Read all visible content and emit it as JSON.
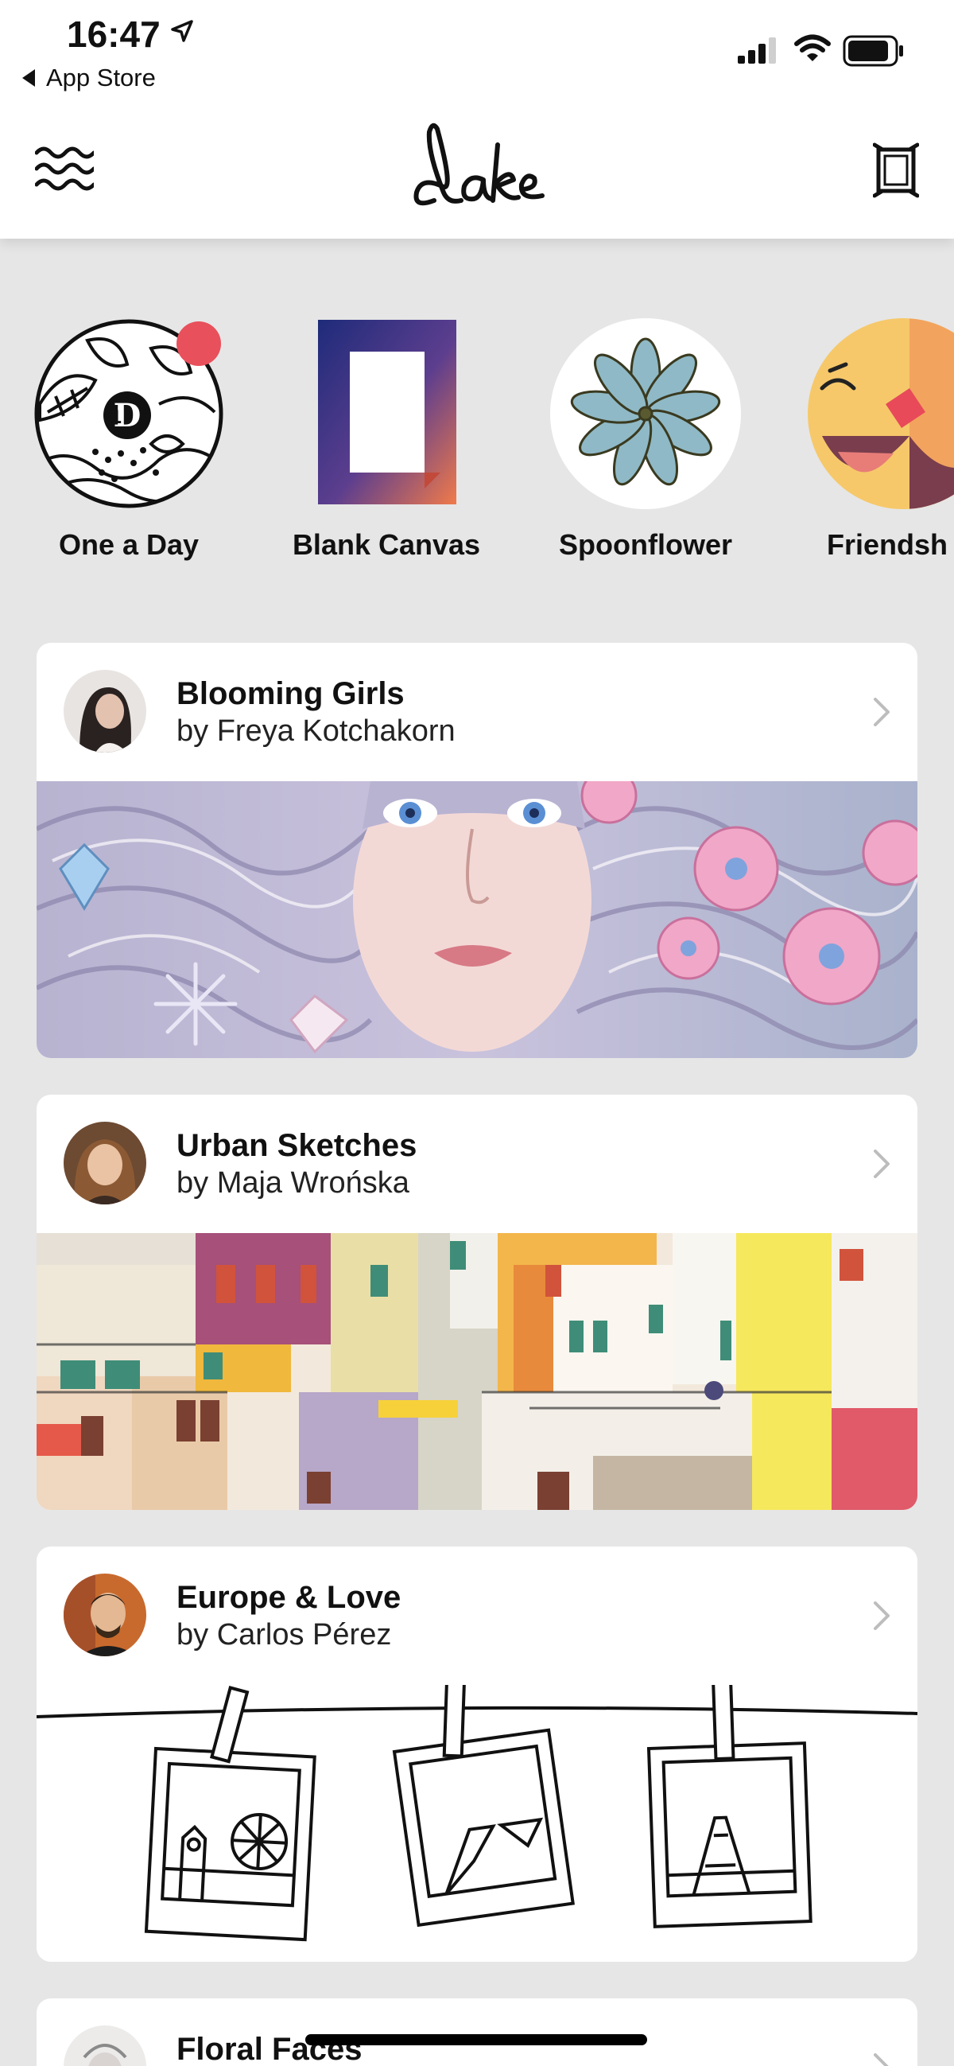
{
  "status": {
    "time": "16:47",
    "back_label": "App Store"
  },
  "header": {
    "logo_text": "Lake"
  },
  "categories": [
    {
      "label": "One a Day",
      "badge": true
    },
    {
      "label": "Blank Canvas"
    },
    {
      "label": "Spoonflower"
    },
    {
      "label": "Friendsh"
    }
  ],
  "cards": [
    {
      "title": "Blooming Girls",
      "author": "by Freya Kotchakorn"
    },
    {
      "title": "Urban Sketches",
      "author": "by Maja Wrońska"
    },
    {
      "title": "Europe & Love",
      "author": "by Carlos Pérez"
    },
    {
      "title": "Floral Faces"
    }
  ],
  "colors": {
    "badge_red": "#e8505b",
    "background": "#e6e6e6",
    "card": "#ffffff"
  }
}
